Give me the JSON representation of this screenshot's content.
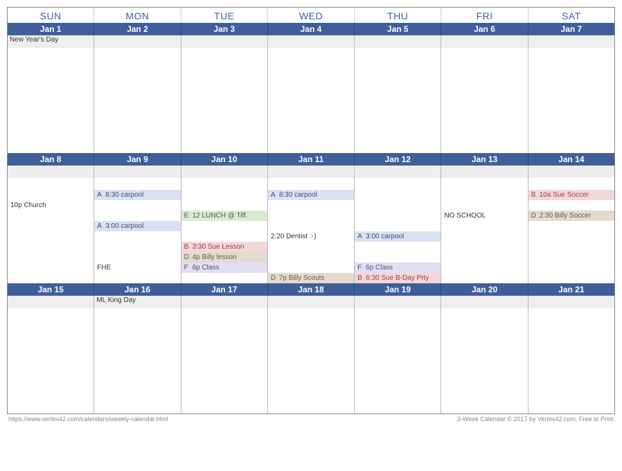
{
  "dow": [
    "SUN",
    "MON",
    "TUE",
    "WED",
    "THU",
    "FRI",
    "SAT"
  ],
  "weeks": [
    {
      "dates": [
        "Jan 1",
        "Jan 2",
        "Jan 3",
        "Jan 4",
        "Jan 5",
        "Jan 6",
        "Jan 7"
      ],
      "holidays": [
        "New Year's Day",
        "",
        "",
        "",
        "",
        "",
        ""
      ],
      "rows": 10,
      "events": {}
    },
    {
      "dates": [
        "Jan 8",
        "Jan 9",
        "Jan 10",
        "Jan 11",
        "Jan 12",
        "Jan 13",
        "Jan 14"
      ],
      "holidays": [
        "",
        "",
        "",
        "",
        "",
        "",
        ""
      ],
      "rows": 10,
      "events": {
        "0": {
          "2": {
            "tag": "",
            "cls": "plain",
            "text": "10p  Church"
          }
        },
        "1": {
          "1": {
            "tag": "A",
            "cls": "A",
            "text": "8:30 carpool"
          },
          "4": {
            "tag": "A",
            "cls": "A",
            "text": "3:00 carpool"
          },
          "8": {
            "tag": "",
            "cls": "plain",
            "text": "FHE"
          }
        },
        "2": {
          "3": {
            "tag": "E",
            "cls": "E",
            "text": "12 LUNCH @ Tiff."
          },
          "6": {
            "tag": "B",
            "cls": "B",
            "text": "3:30 Sue Lesson"
          },
          "7": {
            "tag": "D",
            "cls": "D",
            "text": "4p Billy lesson"
          },
          "8": {
            "tag": "F",
            "cls": "F",
            "text": "6p Class"
          }
        },
        "3": {
          "1": {
            "tag": "A",
            "cls": "A",
            "text": "8:30 carpool"
          },
          "5": {
            "tag": "",
            "cls": "plain",
            "text": "2:20  Dentist :-)"
          },
          "9": {
            "tag": "D",
            "cls": "D",
            "text": "7p Billy Scouts"
          }
        },
        "4": {
          "5": {
            "tag": "A",
            "cls": "A",
            "text": "3:00 carpool"
          },
          "8": {
            "tag": "F",
            "cls": "F",
            "text": "6p Class"
          },
          "9": {
            "tag": "B",
            "cls": "B",
            "text": "6:30 Sue B-Day Prty"
          }
        },
        "5": {
          "3": {
            "tag": "",
            "cls": "plain",
            "text": "NO SCHOOL"
          }
        },
        "6": {
          "1": {
            "tag": "B",
            "cls": "B",
            "text": "10a Sue Soccer"
          },
          "3": {
            "tag": "D",
            "cls": "D",
            "text": "2:30 Billy Soccer"
          }
        }
      }
    },
    {
      "dates": [
        "Jan 15",
        "Jan 16",
        "Jan 17",
        "Jan 18",
        "Jan 19",
        "Jan 20",
        "Jan 21"
      ],
      "holidays": [
        "",
        "ML King Day",
        "",
        "",
        "",
        "",
        ""
      ],
      "rows": 10,
      "events": {}
    }
  ],
  "footer": {
    "left": "https://www.vertex42.com/calendars/weekly-calendar.html",
    "right": "3-Week Calendar © 2017 by Vertex42.com. Free to Print."
  }
}
